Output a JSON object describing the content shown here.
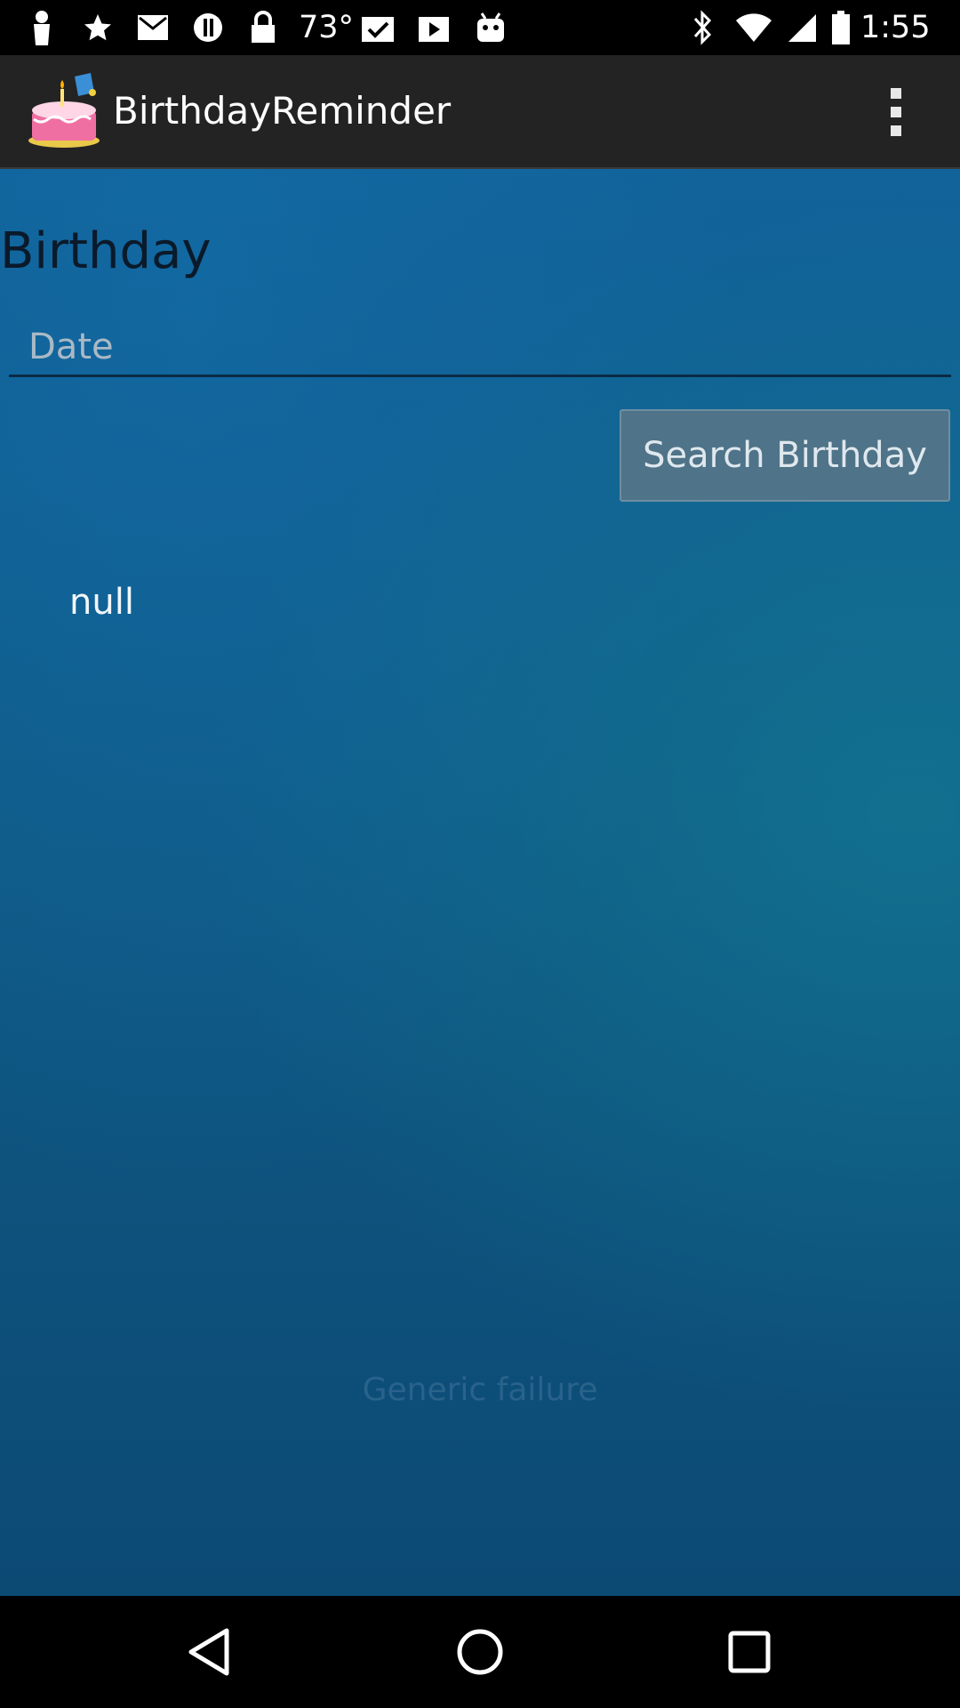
{
  "status_bar": {
    "temperature": "73°",
    "time": "1:55",
    "icons": [
      "person-icon",
      "star-icon",
      "mail-icon",
      "info-icon",
      "lock-icon",
      "clipboard-check-icon",
      "play-store-icon",
      "android-icon",
      "bluetooth-icon",
      "wifi-icon",
      "signal-icon",
      "battery-icon"
    ]
  },
  "action_bar": {
    "app_icon": "birthday-cake-icon",
    "title": "BirthdayReminder",
    "overflow_icon": "overflow-menu-icon"
  },
  "main": {
    "heading": "Birthday",
    "date_placeholder": "Date",
    "date_value": "",
    "search_button_label": "Search Birthday",
    "result_text": "null",
    "toast_text": "Generic failure"
  },
  "nav_bar": {
    "icons": [
      "back-icon",
      "home-icon",
      "recents-icon"
    ]
  },
  "colors": {
    "background_top": "#11639a",
    "background_bottom": "#0c4a74",
    "action_bar": "#232323",
    "button": "#4f7388"
  }
}
